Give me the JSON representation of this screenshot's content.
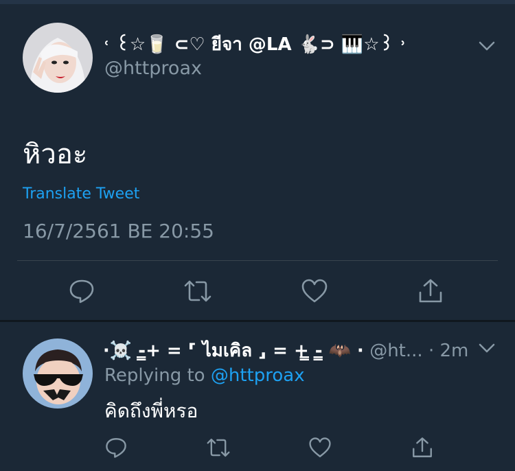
{
  "colors": {
    "background": "#1b2836",
    "accent": "#1da1f2",
    "muted": "#8899a6",
    "divider": "#38444d"
  },
  "tweet": {
    "display_name": "˓ ꒰☆🥛 ⊂♡ ยีจา @LA 🐇⊃ 🎹☆꒱ ˒",
    "handle": "@httproax",
    "text": "หิวอะ",
    "translate_label": "Translate Tweet",
    "timestamp": "16/7/2561 BE 20:55",
    "actions": [
      "reply-icon",
      "retweet-icon",
      "like-icon",
      "share-icon"
    ]
  },
  "reply": {
    "display_name": "⋅☠️ -̳̳̳̳+ = ⸢ ไมเคิล ⸥ = +̳̳̳̳ -̳̳̳̳ 🦇 ⋅",
    "handle": "@ht...",
    "time": "· 2m",
    "replying_prefix": "Replying to",
    "replying_to": "@httproax",
    "text": "คิดถึงพี่หรอ",
    "actions": [
      "reply-icon",
      "retweet-icon",
      "like-icon",
      "share-icon"
    ]
  }
}
